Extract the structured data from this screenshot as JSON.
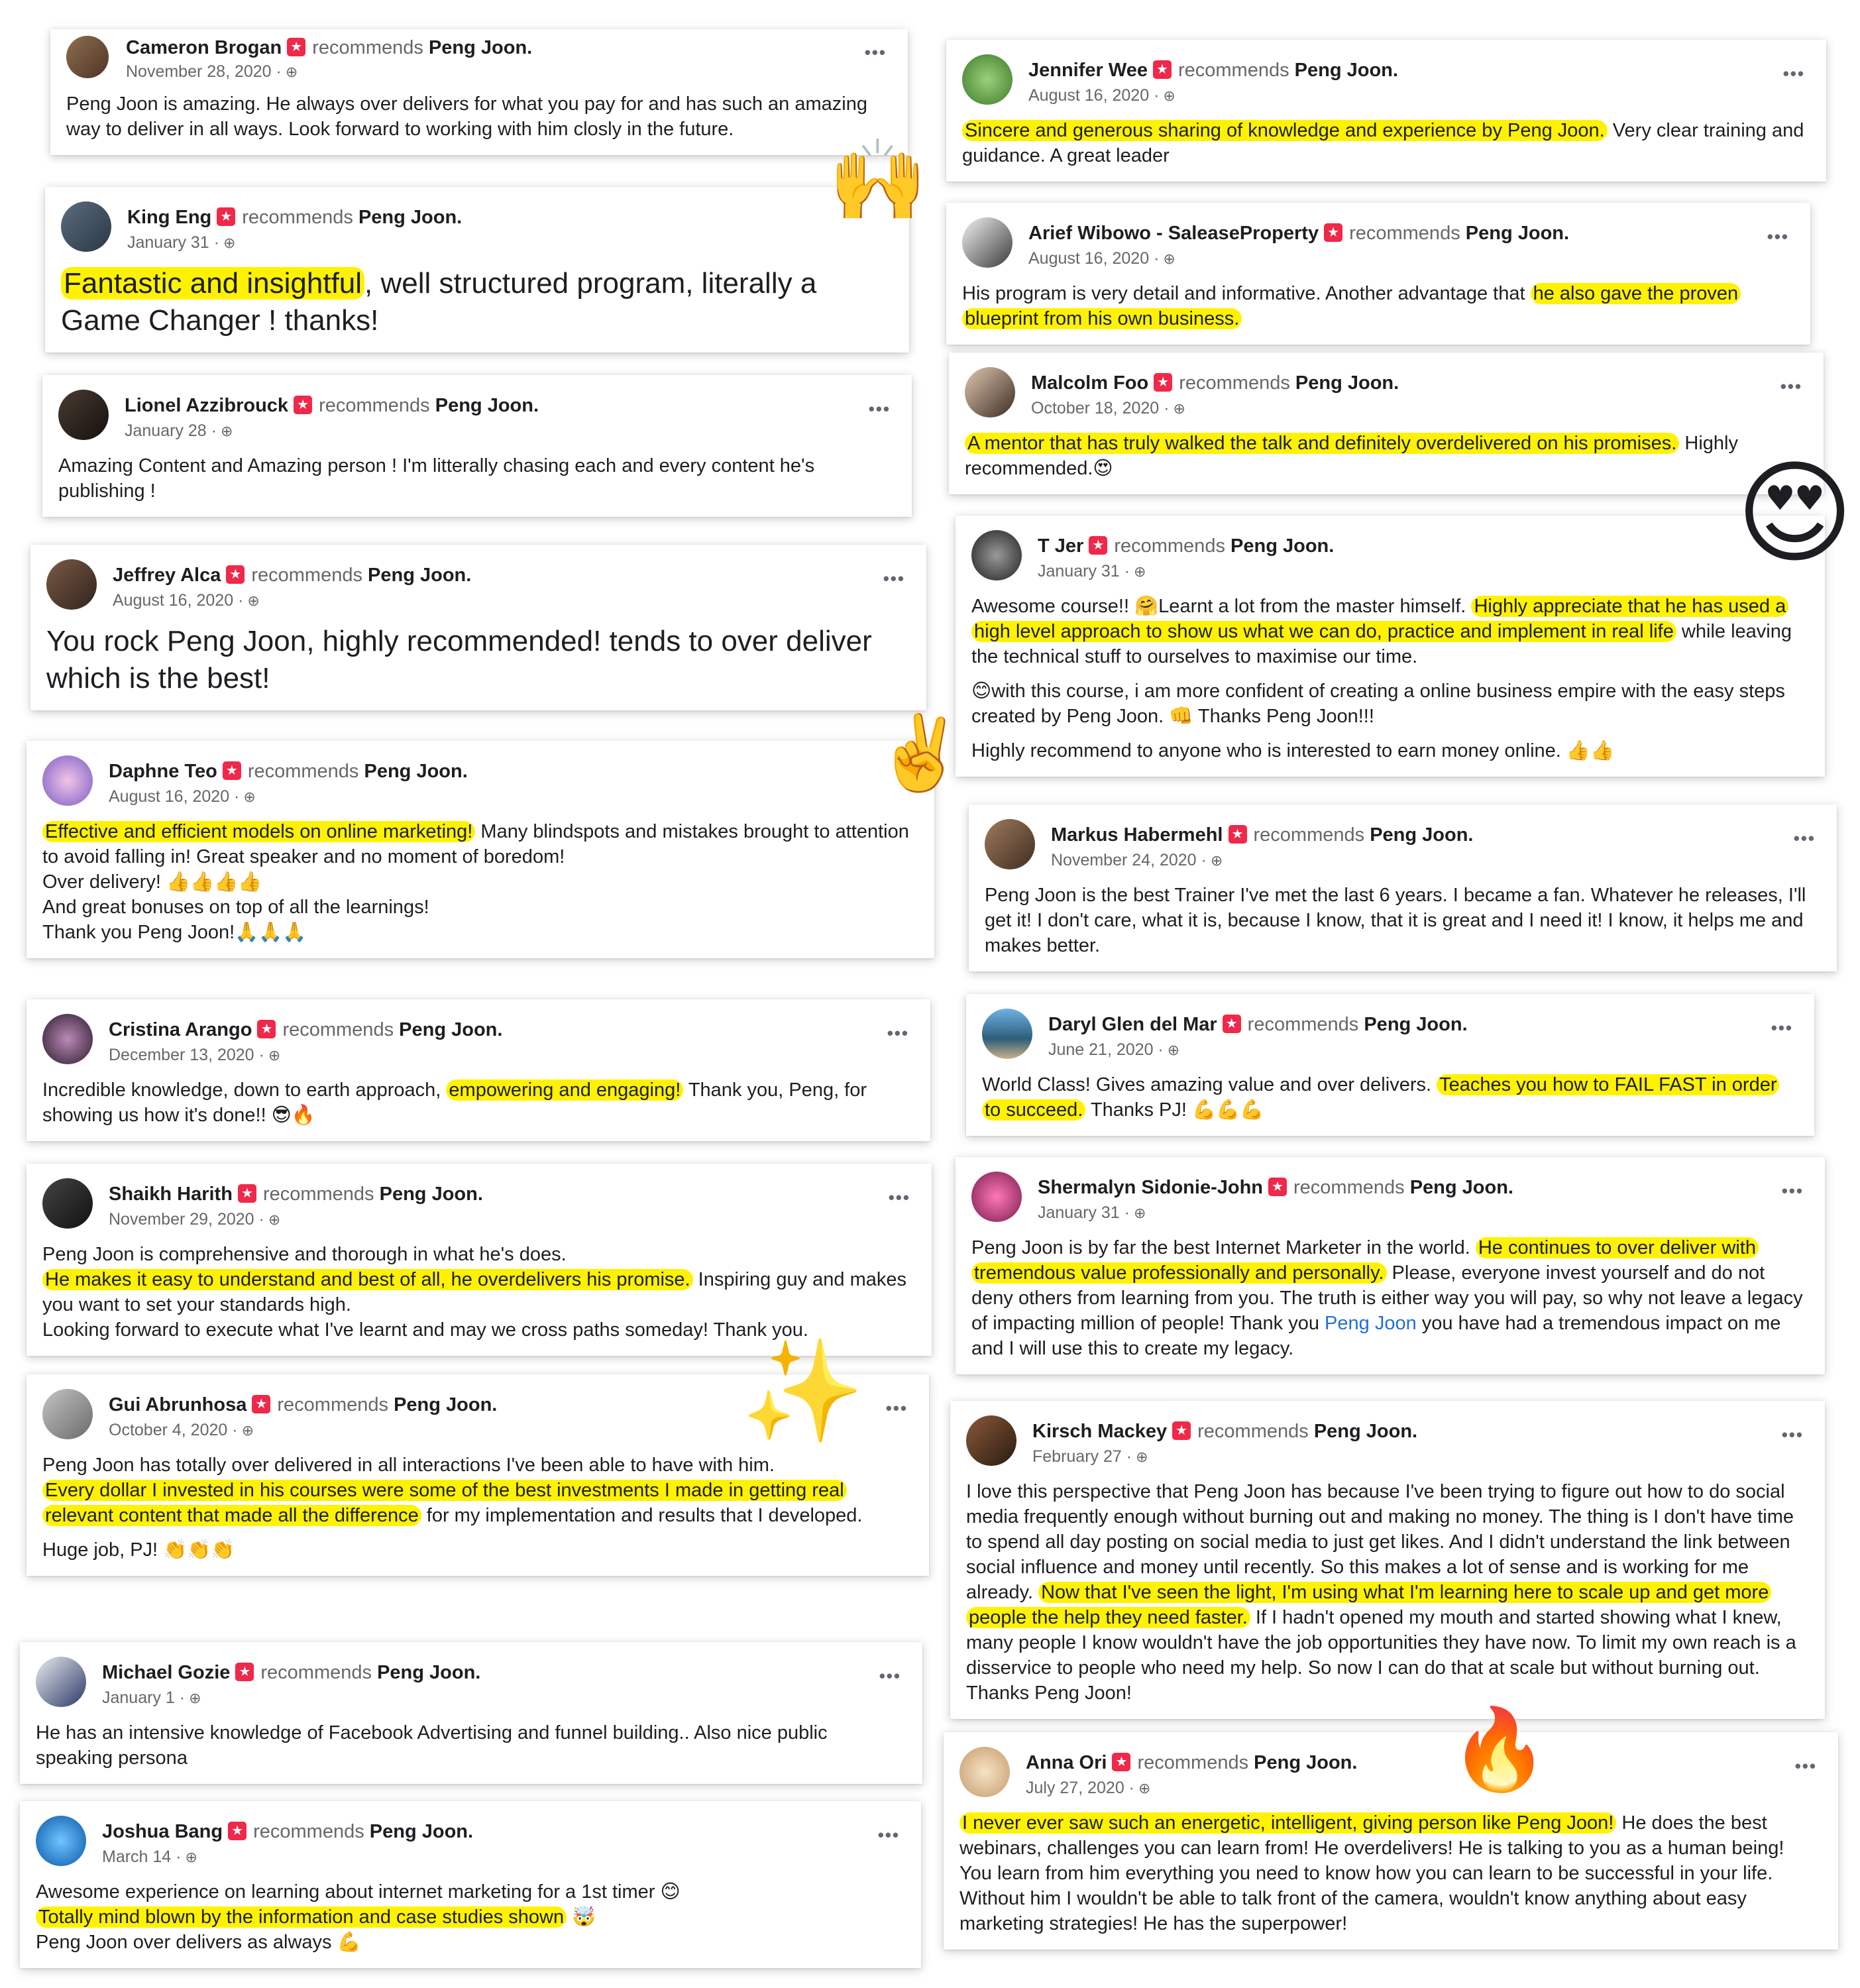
{
  "recommends_text": "recommends",
  "target_name": "Peng Joon.",
  "reviews": {
    "cameron": {
      "name": "Cameron Brogan",
      "date": "November 28, 2020 ·",
      "body": "Peng Joon is amazing. He always over delivers for what you pay for and has such an amazing way to deliver in all ways. Look forward to working with him closly in the future."
    },
    "king": {
      "name": "King Eng",
      "date": "January 31 ·",
      "hl1": "Fantastic and insightful",
      "t1": ", well structured program, literally a Game Changer ! thanks!"
    },
    "lionel": {
      "name": "Lionel Azzibrouck",
      "date": "January 28 ·",
      "body": "Amazing Content and Amazing person ! I'm litterally chasing each and every content he's publishing !"
    },
    "jeffrey": {
      "name": "Jeffrey Alca",
      "date": "August 16, 2020 ·",
      "body": "You rock Peng Joon, highly recommended! tends to over deliver which is the best!"
    },
    "daphne": {
      "name": "Daphne Teo",
      "date": "August 16, 2020 ·",
      "hl1": "Effective and efficient models on online marketing!",
      "t1": " Many blindspots and mistakes brought to attention to avoid falling in! Great speaker and no moment of boredom!",
      "l2": "Over delivery! 👍👍👍👍",
      "l3": "And great bonuses on top of all the learnings!",
      "l4": "Thank you Peng Joon!🙏🙏🙏"
    },
    "cristina": {
      "name": "Cristina Arango",
      "date": "December 13, 2020 ·",
      "t1": "Incredible knowledge, down to earth approach, ",
      "hl1": "empowering and engaging!",
      "t2": " Thank you, Peng, for showing us how it's done!! 😎🔥"
    },
    "shaikh": {
      "name": "Shaikh Harith",
      "date": "November 29, 2020 ·",
      "l1": "Peng Joon is comprehensive and thorough in what he's does.",
      "hl1": "He makes it easy to understand and best of all, he overdelivers his promise.",
      "t2": " Inspiring guy and makes you want to set your standards high.",
      "l3": "Looking forward to execute what I've learnt and may we cross paths someday! Thank you."
    },
    "gui": {
      "name": "Gui Abrunhosa",
      "date": "October 4, 2020 ·",
      "l1": "Peng Joon has totally over delivered in all interactions I've been able to have with him.",
      "hl1": "Every dollar I invested in his courses were some of the best investments I made in getting real relevant content that made all the difference",
      "t2": " for my implementation and results that I developed.",
      "l3": "Huge job, PJ! 👏👏👏"
    },
    "michael": {
      "name": "Michael Gozie",
      "date": "January 1 ·",
      "body": "He has an intensive knowledge of Facebook Advertising and funnel building.. Also nice public speaking persona"
    },
    "joshua": {
      "name": "Joshua Bang",
      "date": "March 14 ·",
      "l1": "Awesome experience on learning about internet marketing for a 1st timer 😊",
      "hl1": "Totally mind blown by the information and case studies shown",
      "t2": " 🤯",
      "l3": "Peng Joon over delivers as always 💪"
    },
    "jennifer": {
      "name": "Jennifer Wee",
      "date": "August 16, 2020 ·",
      "hl1": "Sincere and generous sharing of knowledge and experience by Peng Joon.",
      "t2": " Very clear training and guidance. A great leader"
    },
    "arief": {
      "name": "Arief Wibowo - SaleaseProperty",
      "date": "August 16, 2020 ·",
      "t1": "His program is very detail and informative. Another advantage that ",
      "hl1": "he also gave the proven blueprint from his own business."
    },
    "malcolm": {
      "name": "Malcolm Foo",
      "date": "October 18, 2020 ·",
      "hl1": "A mentor that has truly walked the talk and definitely overdelivered on his promises.",
      "t2": " Highly recommended.😍"
    },
    "tjer": {
      "name": "T Jer",
      "date": "January 31 ·",
      "t1": "Awesome course!! 🤗Learnt a lot from the master himself. ",
      "hl1": "Highly appreciate that he has used a high level approach to show us what we can do, practice and implement in real life",
      "t2": " while leaving the  technical stuff to ourselves to maximise our time.",
      "p2": "😊with this course, i am more confident of creating a online business empire with the easy steps created by Peng Joon. 👊 Thanks Peng Joon!!!",
      "p3": "Highly recommend to anyone who is interested to earn money online. 👍👍"
    },
    "markus": {
      "name": "Markus Habermehl",
      "date": "November 24, 2020 ·",
      "body": "Peng Joon is the best Trainer I've met the last 6 years. I became a fan. Whatever he releases, I'll get it! I don't care, what it is, because I know, that it is great and I need it! I know, it helps me and makes better."
    },
    "daryl": {
      "name": "Daryl Glen del Mar",
      "date": "June 21, 2020 ·",
      "t1": "World Class! Gives amazing value and over delivers. ",
      "hl1": "Teaches you how to FAIL FAST in order to succeed.",
      "t2": " Thanks PJ! 💪💪💪"
    },
    "shermalyn": {
      "name": "Shermalyn Sidonie-John",
      "date": "January 31 ·",
      "t1": "Peng Joon is by far the best Internet Marketer in the world. ",
      "hl1": "He continues to over deliver with tremendous value professionally and personally.",
      "t2": " Please, everyone invest yourself and do not deny others from learning from you. The truth is either way you will pay, so why not leave a legacy of impacting million of people!  Thank you ",
      "link": "Peng Joon",
      "t3": " you have had a tremendous impact on me and I will use this to create my legacy."
    },
    "kirsch": {
      "name": "Kirsch Mackey",
      "date": "February 27 ·",
      "t1": "I love this perspective that Peng Joon has because I've been trying to figure out how to do social media frequently enough without burning out and making no money. The thing is I don't have time to spend all day posting on social media to just get likes. And I didn't understand the link between social influence and money until recently. So this makes a lot of sense and is working for me already. ",
      "hl1": "Now that I've seen the light, I'm using what I'm learning here to scale up and get more people the help they need faster.",
      "t2": " If I hadn't opened my mouth and started showing what I knew, many people I know wouldn't have the job opportunities they have now. To limit my own reach is a disservice to people who need my help. So now I can do that at scale but without burning out. Thanks Peng Joon!"
    },
    "anna": {
      "name": "Anna Ori",
      "date": "July 27, 2020 ·",
      "hl1": "I never ever saw such an energetic, intelligent, giving person like Peng Joon!",
      "t2": " He does the best webinars, challenges you can learn from! He overdelivers! He is talking to you as a human being! You learn from him everything you need to know how you can learn to be successful in your life. Without him I wouldn't be able to talk front of the camera, wouldn't know anything about easy marketing strategies! He has the superpower!"
    }
  },
  "decorations": {
    "raise_hands": "🙌",
    "heart_eyes": "😍",
    "victory": "✌️",
    "sparkles": "✨",
    "fire": "🔥"
  },
  "colors": {
    "highlight": "#fff200",
    "recommend_icon": "#f02849",
    "link": "#216fdb",
    "secondary_text": "#65676b"
  }
}
